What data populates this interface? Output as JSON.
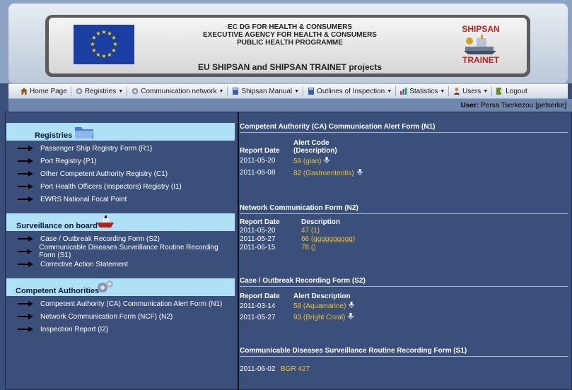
{
  "header": {
    "line1": "EC DG FOR HEALTH & CONSUMERS",
    "line2": "EXECUTIVE AGENCY FOR HEALTH & CONSUMERS",
    "line3": "PUBLIC HEALTH PROGRAMME",
    "title": "EU SHIPSAN and SHIPSAN TRAINET projects",
    "logo_top": "SHIPSAN",
    "logo_bottom": "TRAINET"
  },
  "menu": [
    {
      "label": "Home Page",
      "icon": "home-icon",
      "caret": false
    },
    {
      "label": "Registries",
      "icon": "gear-icon",
      "caret": true
    },
    {
      "label": "Communication network",
      "icon": "gear-icon",
      "caret": true
    },
    {
      "label": "Shipsan Manual",
      "icon": "book-icon",
      "caret": true
    },
    {
      "label": "Outlines of Inspection",
      "icon": "book-icon",
      "caret": true
    },
    {
      "label": "Statistics",
      "icon": "chart-icon",
      "caret": true
    },
    {
      "label": "Users",
      "icon": "users-icon",
      "caret": true
    },
    {
      "label": "Logout",
      "icon": "logout-icon",
      "caret": false
    }
  ],
  "user": {
    "label": "User:",
    "name": "Persa Tserkezou [petserke]"
  },
  "sidebar": {
    "sections": [
      {
        "title": "Registries",
        "icon": "folder-icon",
        "items": [
          "Passenger Ship Registry Form (R1)",
          "Port Registry (P1)",
          "Other Competent Authority Registry (C1)",
          "Port Health Officers (Inspectors) Registry (I1)",
          "EWRS National Focal Point"
        ]
      },
      {
        "title": "Surveillance on board",
        "icon": "ship-icon",
        "items": [
          "Case / Outbreak Recording Form (S2)",
          "Communicable Diseases Surveillance Routine Recording Form (S1)",
          "Corrective Action Statement"
        ]
      },
      {
        "title": "Competent Authorities",
        "icon": "gears-icon",
        "items": [
          "Competent Authority (CA) Communication Alert Form (N1)",
          "Network Communication Form (NCF) (N2)",
          "Inspection Report (I2)"
        ]
      }
    ]
  },
  "forms": {
    "n1": {
      "title": "Competent Authority (CA) Communication Alert Form (N1)",
      "col1": "Report Date",
      "col2": "Alert Code (Description)",
      "rows": [
        {
          "date": "2011-05-20",
          "link": "59 (gian)"
        },
        {
          "date": "2011-06-08",
          "link": "82 (Gastroenteritis)"
        }
      ]
    },
    "n2": {
      "title": "Network Communication Form (N2)",
      "col1": "Report Date",
      "col2": "Description",
      "rows": [
        {
          "date": "2011-05-20",
          "link": "47 (1)"
        },
        {
          "date": "2011-05-27",
          "link": "66 (gggggggggg)"
        },
        {
          "date": "2011-06-15",
          "link": "78 ()"
        }
      ]
    },
    "s2": {
      "title": "Case / Outbreak Recording Form (S2)",
      "col1": "Report Date",
      "col2": "Alert Description",
      "rows": [
        {
          "date": "2011-03-14",
          "link": "58 (Aquamarine)"
        },
        {
          "date": "2011-05-27",
          "link": "93 (Bright Coral)"
        }
      ]
    },
    "s1": {
      "title": "Communicable Diseases Surveillance Routine Recording Form (S1)",
      "rows": [
        {
          "date": "2011-06-02",
          "link": "BGR 427"
        }
      ]
    }
  }
}
